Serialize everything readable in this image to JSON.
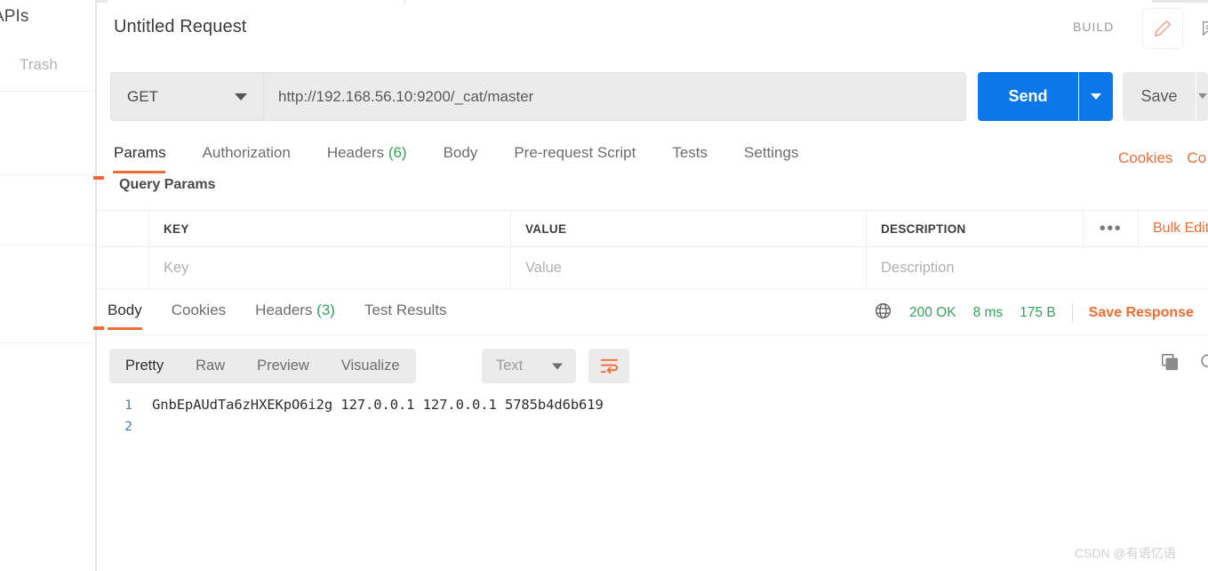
{
  "sidebar": {
    "items": [
      {
        "label": "APIs"
      },
      {
        "label": "Trash"
      }
    ]
  },
  "request": {
    "title": "Untitled Request",
    "build_label": "BUILD",
    "edit_icon": "pencil-icon",
    "comment_icon": "comment-icon",
    "method": "GET",
    "url": "http://192.168.56.10:9200/_cat/master",
    "send_label": "Send",
    "save_label": "Save",
    "tabs": [
      {
        "label": "Params",
        "active": true,
        "count": ""
      },
      {
        "label": "Authorization",
        "active": false,
        "count": ""
      },
      {
        "label": "Headers",
        "active": false,
        "count": "(6)"
      },
      {
        "label": "Body",
        "active": false,
        "count": ""
      },
      {
        "label": "Pre-request Script",
        "active": false,
        "count": ""
      },
      {
        "label": "Tests",
        "active": false,
        "count": ""
      },
      {
        "label": "Settings",
        "active": false,
        "count": ""
      }
    ],
    "cookies_link": "Cookies",
    "code_link": "Co"
  },
  "params": {
    "section_title": "Query Params",
    "columns": [
      "KEY",
      "VALUE",
      "DESCRIPTION"
    ],
    "row_placeholders": [
      "Key",
      "Value",
      "Description"
    ],
    "more_icon": "ellipsis-icon",
    "bulk_edit_label": "Bulk Edit"
  },
  "response": {
    "tabs": [
      {
        "label": "Body",
        "active": true,
        "count": ""
      },
      {
        "label": "Cookies",
        "active": false,
        "count": ""
      },
      {
        "label": "Headers",
        "active": false,
        "count": "(3)"
      },
      {
        "label": "Test Results",
        "active": false,
        "count": ""
      }
    ],
    "globe_icon": "globe-icon",
    "status_code": "200 OK",
    "time": "8 ms",
    "size": "175 B",
    "save_response_label": "Save Response",
    "format_tabs": [
      {
        "label": "Pretty",
        "active": true
      },
      {
        "label": "Raw",
        "active": false
      },
      {
        "label": "Preview",
        "active": false
      },
      {
        "label": "Visualize",
        "active": false
      }
    ],
    "content_type": "Text",
    "wrap_icon": "word-wrap-icon",
    "copy_icon": "copy-icon",
    "search_icon": "search-icon",
    "body_lines": [
      {
        "number": "1",
        "text": "GnbEpAUdTa6zHXEKpO6i2g 127.0.0.1 127.0.0.1 5785b4d6b619"
      },
      {
        "number": "2",
        "text": ""
      }
    ]
  },
  "watermark": "CSDN @有语忆语",
  "colors": {
    "accent_orange": "#ef6c33",
    "send_blue": "#0c77e8",
    "status_green": "#33a457",
    "count_green": "#2aa659"
  }
}
